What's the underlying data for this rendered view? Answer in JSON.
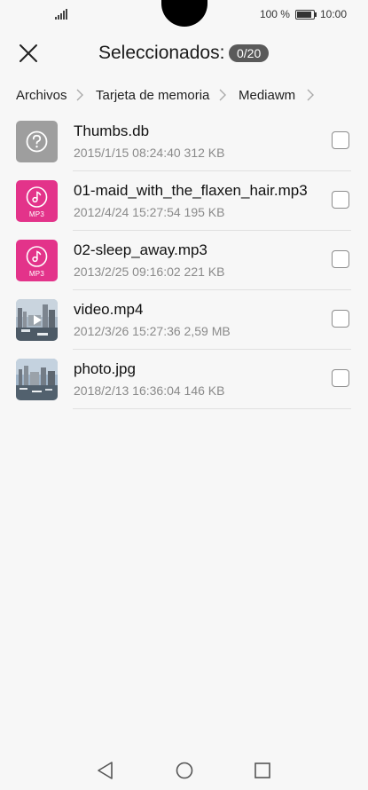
{
  "status_bar": {
    "battery_text": "100 %",
    "time": "10:00"
  },
  "header": {
    "title": "Seleccionados:",
    "count": "0/20",
    "close_icon": "close-icon"
  },
  "breadcrumb": [
    "Archivos",
    "Tarjeta de memoria",
    "Mediawm"
  ],
  "files": [
    {
      "name": "Thumbs.db",
      "meta": "2015/1/15 08:24:40 312 KB",
      "icon": "unknown-file-icon",
      "checked": false
    },
    {
      "name": "01-maid_with_the_flaxen_hair.mp3",
      "meta": "2012/4/24 15:27:54 195 KB",
      "icon": "mp3-file-icon",
      "badge": "MP3",
      "checked": false
    },
    {
      "name": "02-sleep_away.mp3",
      "meta": "2013/2/25 09:16:02 221 KB",
      "icon": "mp3-file-icon",
      "badge": "MP3",
      "checked": false
    },
    {
      "name": "video.mp4",
      "meta": "2012/3/26 15:27:36 2,59 MB",
      "icon": "video-thumbnail",
      "checked": false
    },
    {
      "name": "photo.jpg",
      "meta": "2018/2/13 16:36:04 146 KB",
      "icon": "photo-thumbnail",
      "checked": false
    }
  ],
  "colors": {
    "mp3_accent": "#e3338a",
    "unknown_file": "#9e9e9e",
    "badge_bg": "#5a5a5a"
  }
}
